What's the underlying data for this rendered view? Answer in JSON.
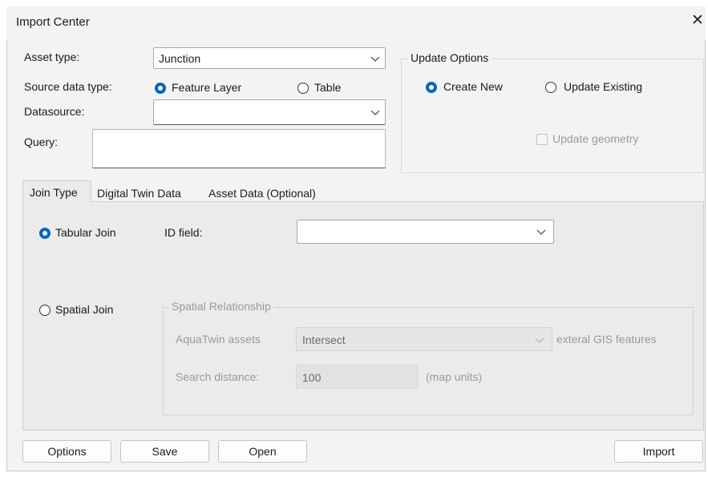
{
  "window": {
    "title": "Import Center",
    "close_glyph": "✕"
  },
  "form": {
    "asset_type_label": "Asset type:",
    "asset_type_value": "Junction",
    "source_type_label": "Source data type:",
    "source_options": [
      "Feature Layer",
      "Table"
    ],
    "source_selected": "Feature Layer",
    "datasource_label": "Datasource:",
    "datasource_value": "",
    "query_label": "Query:",
    "query_value": ""
  },
  "update_options": {
    "title": "Update Options",
    "create_new": "Create New",
    "update_existing": "Update Existing",
    "selected": "Create New",
    "update_geometry": "Update geometry",
    "update_geometry_checked": false
  },
  "tabs": [
    "Join Type",
    "Digital Twin Data",
    "Asset Data (Optional)"
  ],
  "active_tab": "Join Type",
  "join": {
    "tabular_join": "Tabular Join",
    "spatial_join": "Spatial Join",
    "selected": "Tabular Join",
    "id_field_label": "ID field:",
    "id_field_value": "",
    "spatial_group_title": "Spatial Relationship",
    "aquatwin_label": "AquaTwin assets",
    "relationship_value": "Intersect",
    "external_label": "exteral GIS features",
    "search_distance_label": "Search distance:",
    "search_distance_value": "100",
    "map_units_label": "(map units)"
  },
  "buttons": {
    "options": "Options",
    "save": "Save",
    "open": "Open",
    "import": "Import"
  },
  "colors": {
    "accent": "#0067c0",
    "window_bg": "#f3f3f3",
    "panel_bg": "#ebebeb",
    "disabled_text": "#9a9a9a"
  }
}
